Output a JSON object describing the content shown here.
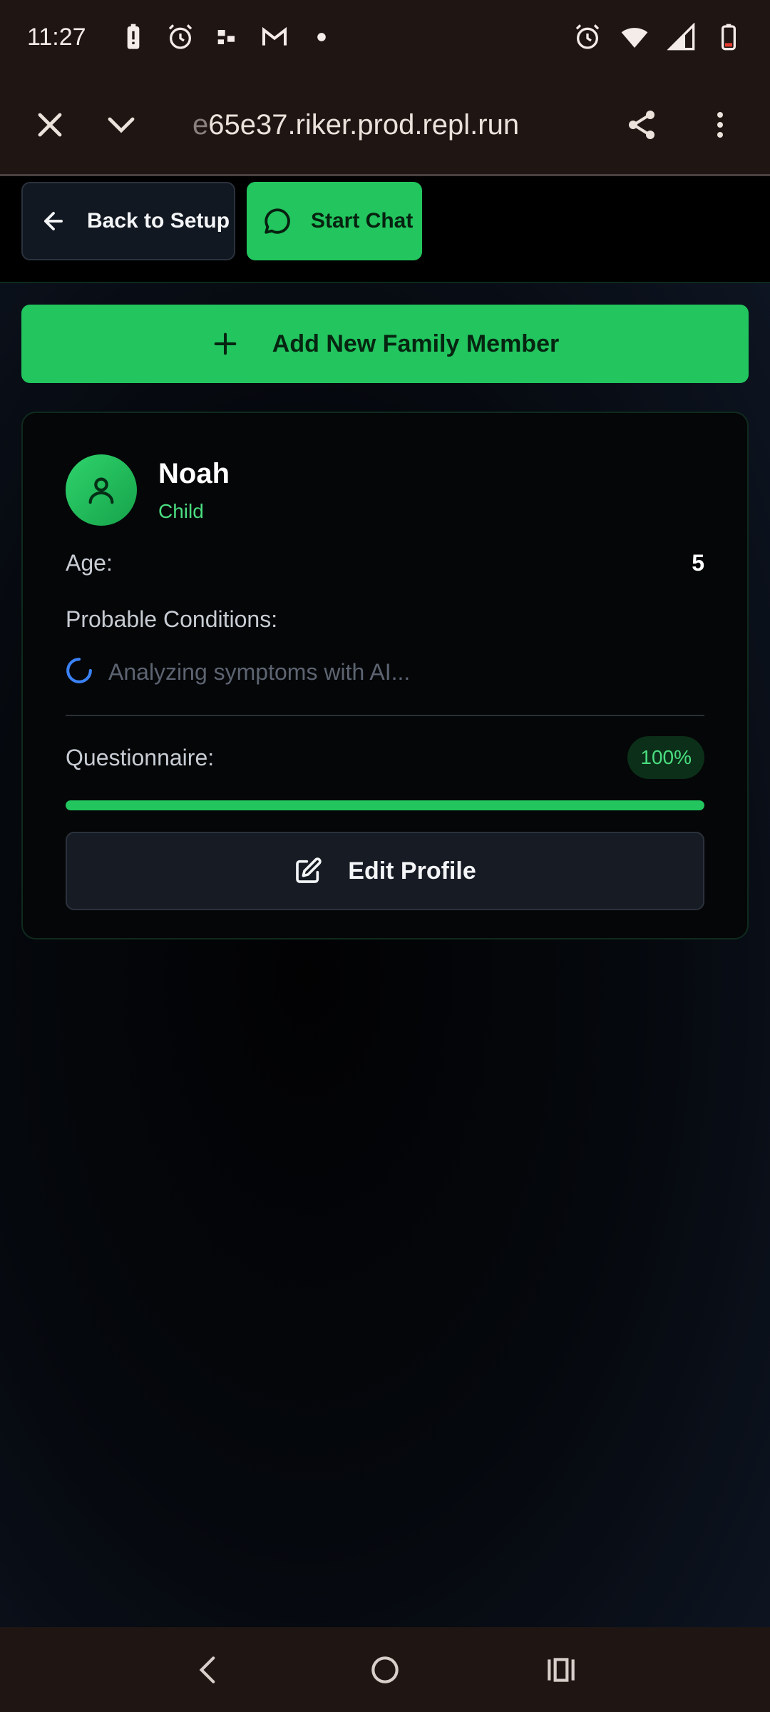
{
  "status_bar": {
    "time": "11:27",
    "left_icons": [
      "battery-alert-icon",
      "alarm-icon",
      "app-notification-icon",
      "gmail-icon",
      "dot-icon"
    ],
    "right_icons": [
      "alarm-icon",
      "wifi-icon",
      "signal-icon",
      "battery-low-icon"
    ]
  },
  "browser": {
    "url_faded": "e",
    "url": "65e37.riker.prod.repl.run"
  },
  "actions": {
    "back_label": "Back to Setup",
    "chat_label": "Start Chat",
    "add_member_label": "Add New Family Member"
  },
  "member": {
    "name": "Noah",
    "role": "Child",
    "age_label": "Age:",
    "age_value": "5",
    "conditions_label": "Probable Conditions:",
    "analyzing_text": "Analyzing symptoms with AI...",
    "questionnaire_label": "Questionnaire:",
    "questionnaire_badge": "100%",
    "questionnaire_progress": 1.0,
    "edit_label": "Edit Profile"
  },
  "colors": {
    "accent_green": "#22c55e",
    "role_green": "#4ade80",
    "system_bar": "#1f1512",
    "spinner_blue": "#3b82f6"
  }
}
